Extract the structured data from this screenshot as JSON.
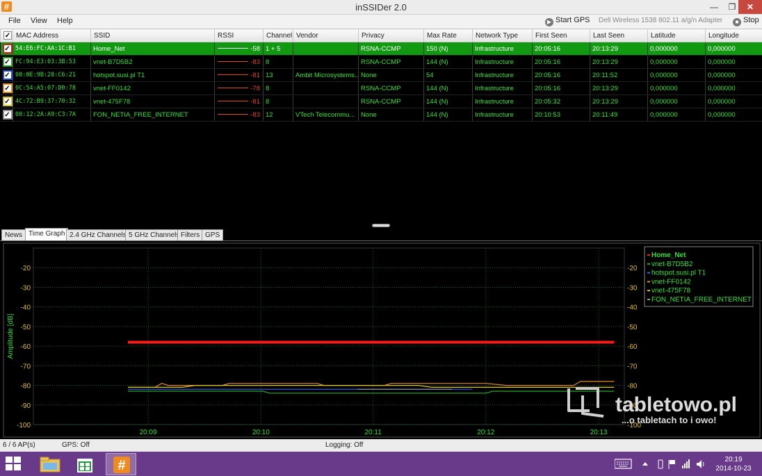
{
  "window": {
    "title": "inSSIDer 2.0",
    "min_glyph": "—",
    "max_glyph": "❐",
    "close_glyph": "✕"
  },
  "menu": {
    "file": "File",
    "view": "View",
    "help": "Help",
    "start_gps": "Start GPS",
    "adapter": "Dell Wireless 1538 802.11 a/g/n Adapter",
    "stop": "Stop"
  },
  "table": {
    "columns": [
      "",
      "MAC Address",
      "SSID",
      "RSSI",
      "Channel",
      "Vendor",
      "Privacy",
      "Max Rate",
      "Network Type",
      "First Seen",
      "Last Seen",
      "Latitude",
      "Longitude"
    ],
    "rows": [
      {
        "checkColor": "#d02020",
        "mac": "54:E6:FC:AA:1C:B1",
        "ssid": "Home_Net",
        "rssi": "-58",
        "channel": "1 + 5",
        "vendor": "",
        "privacy": "RSNA-CCMP",
        "max_rate": "150 (N)",
        "network_type": "Infrastructure",
        "first_seen": "20:05:16",
        "last_seen": "20:13:29",
        "latitude": "0,000000",
        "longitude": "0,000000",
        "selected": true
      },
      {
        "checkColor": "#2aa82a",
        "mac": "FC:94:E3:03:3B:53",
        "ssid": "vnet-B7D5B2",
        "rssi": "-83",
        "channel": "8",
        "vendor": "",
        "privacy": "RSNA-CCMP",
        "max_rate": "144 (N)",
        "network_type": "Infrastructure",
        "first_seen": "20:05:16",
        "last_seen": "20:13:29",
        "latitude": "0,000000",
        "longitude": "0,000000",
        "selected": false
      },
      {
        "checkColor": "#2050d0",
        "mac": "00:0E:9B:28:C6:21",
        "ssid": "hotspot.susi.pl T1",
        "rssi": "-81",
        "channel": "13",
        "vendor": "Ambit Microsystems...",
        "privacy": "None",
        "max_rate": "54",
        "network_type": "Infrastructure",
        "first_seen": "20:05:16",
        "last_seen": "20:11:52",
        "latitude": "0,000000",
        "longitude": "0,000000",
        "selected": false
      },
      {
        "checkColor": "#e09020",
        "mac": "0C:54:A5:07:D0:78",
        "ssid": "vnet-FF0142",
        "rssi": "-78",
        "channel": "8",
        "vendor": "",
        "privacy": "RSNA-CCMP",
        "max_rate": "144 (N)",
        "network_type": "Infrastructure",
        "first_seen": "20:05:16",
        "last_seen": "20:13:29",
        "latitude": "0,000000",
        "longitude": "0,000000",
        "selected": false
      },
      {
        "checkColor": "#d0c020",
        "mac": "4C:72:B9:37:70:32",
        "ssid": "vnet-475F78",
        "rssi": "-81",
        "channel": "8",
        "vendor": "",
        "privacy": "RSNA-CCMP",
        "max_rate": "144 (N)",
        "network_type": "Infrastructure",
        "first_seen": "20:05:32",
        "last_seen": "20:13:29",
        "latitude": "0,000000",
        "longitude": "0,000000",
        "selected": false
      },
      {
        "checkColor": "#909090",
        "mac": "00:12:2A:A9:C3:7A",
        "ssid": "FON_NETIA_FREE_INTERNET",
        "rssi": "-83",
        "channel": "12",
        "vendor": "VTech Telecommu...",
        "privacy": "None",
        "max_rate": "144 (N)",
        "network_type": "Infrastructure",
        "first_seen": "20:10:53",
        "last_seen": "20:11:49",
        "latitude": "0,000000",
        "longitude": "0,000000",
        "selected": false
      }
    ]
  },
  "tabs": [
    "News",
    "Time Graph",
    "2.4 GHz Channels",
    "5 GHz Channels",
    "Filters",
    "GPS"
  ],
  "active_tab": "Time Graph",
  "chart_data": {
    "type": "line",
    "ylabel": "Amplitude [dB]",
    "ylim": [
      -100,
      -10
    ],
    "yticks": [
      -20,
      -30,
      -40,
      -50,
      -60,
      -70,
      -80,
      -90,
      -100
    ],
    "xticks": [
      "20:09",
      "20:10",
      "20:11",
      "20:12",
      "20:13"
    ],
    "grid": true,
    "legend_position": "top-right",
    "series": [
      {
        "name": "Home_Net",
        "color": "#ff1a1a",
        "bold": true,
        "points": [
          [
            20.147,
            -58
          ],
          [
            20.219,
            -58
          ]
        ]
      },
      {
        "name": "vnet-B7D5B2",
        "color": "#2aa82a",
        "points": [
          [
            20.147,
            -83
          ],
          [
            20.167,
            -83
          ],
          [
            20.168,
            -84
          ],
          [
            20.2,
            -84
          ],
          [
            20.201,
            -83
          ],
          [
            20.219,
            -83
          ]
        ]
      },
      {
        "name": "hotspot.susi.pl T1",
        "color": "#3060ff",
        "points": [
          [
            20.147,
            -82
          ],
          [
            20.19,
            -82
          ],
          [
            20.198,
            -82
          ]
        ]
      },
      {
        "name": "vnet-FF0142",
        "color": "#e08a1c",
        "points": [
          [
            20.147,
            -81
          ],
          [
            20.151,
            -81
          ],
          [
            20.152,
            -79
          ],
          [
            20.153,
            -80
          ],
          [
            20.161,
            -80
          ],
          [
            20.162,
            -79
          ],
          [
            20.175,
            -79
          ],
          [
            20.176,
            -80
          ],
          [
            20.185,
            -80
          ],
          [
            20.186,
            -79
          ],
          [
            20.2,
            -79
          ],
          [
            20.203,
            -80
          ],
          [
            20.213,
            -80
          ],
          [
            20.214,
            -78
          ],
          [
            20.219,
            -78
          ]
        ]
      },
      {
        "name": "vnet-475F78",
        "color": "#d8c828",
        "points": [
          [
            20.147,
            -81
          ],
          [
            20.155,
            -81
          ],
          [
            20.157,
            -80
          ],
          [
            20.19,
            -80
          ],
          [
            20.192,
            -81
          ],
          [
            20.219,
            -81
          ]
        ]
      },
      {
        "name": "FON_NETIA_FREE_INTERNET",
        "color": "#9a9a9a",
        "points": [
          [
            20.181,
            -82
          ],
          [
            20.195,
            -82
          ]
        ]
      }
    ]
  },
  "watermark": {
    "brand": "tabletowo.pl",
    "tagline": "...o tabletach to i owo!"
  },
  "status": {
    "ap_count": "6 / 6 AP(s)",
    "gps": "GPS: Off",
    "logging": "Logging: Off"
  },
  "taskbar": {
    "time": "20:19",
    "date": "2014-10-23"
  }
}
